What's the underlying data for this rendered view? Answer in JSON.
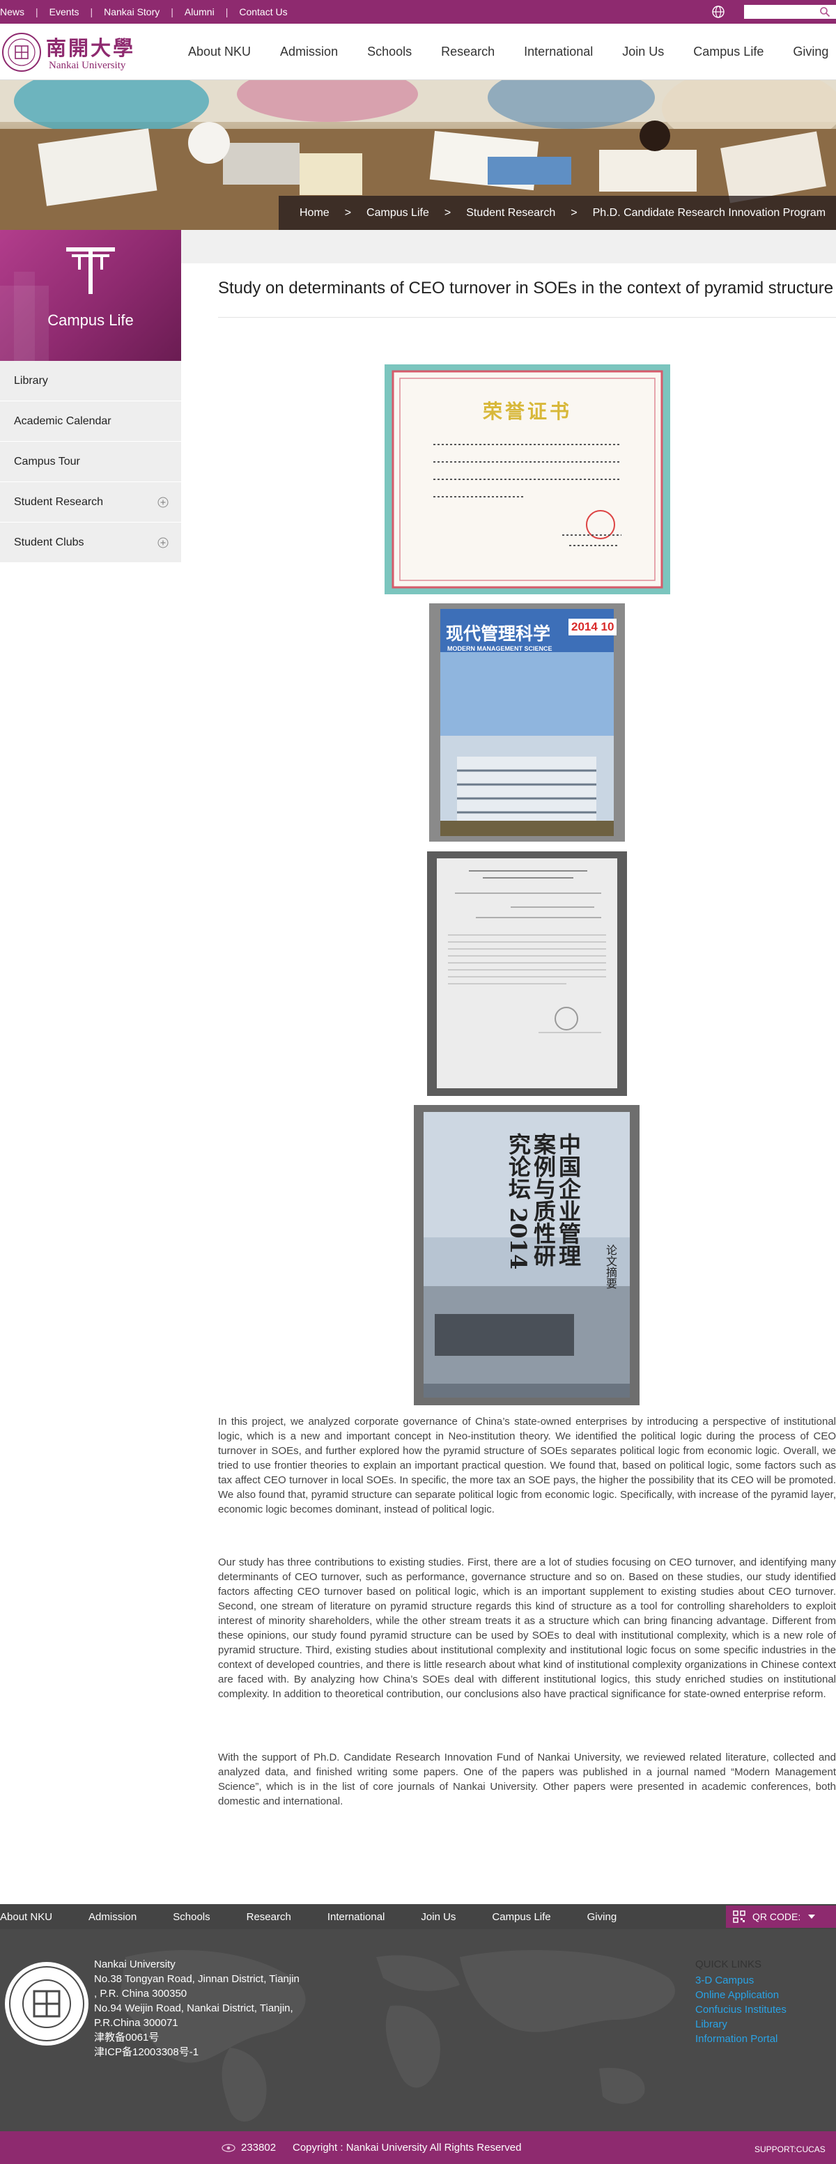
{
  "top_links": [
    "News",
    "Events",
    "Nankai Story",
    "Alumni",
    "Contact Us"
  ],
  "search": {
    "placeholder": ""
  },
  "logo": {
    "cn": "南開大學",
    "en": "Nankai University"
  },
  "main_nav": [
    "About NKU",
    "Admission",
    "Schools",
    "Research",
    "International",
    "Join Us",
    "Campus Life",
    "Giving"
  ],
  "breadcrumb": [
    "Home",
    "Campus Life",
    "Student Research",
    "Ph.D. Candidate Research Innovation Program"
  ],
  "breadcrumb_separator": ">",
  "sidebar": {
    "title": "Campus Life",
    "items": [
      {
        "label": "Library",
        "expandable": false
      },
      {
        "label": "Academic Calendar",
        "expandable": false
      },
      {
        "label": "Campus Tour",
        "expandable": false
      },
      {
        "label": "Student Research",
        "expandable": true
      },
      {
        "label": "Student Clubs",
        "expandable": true
      }
    ]
  },
  "article": {
    "title": "Study on determinants of CEO turnover in SOEs in the context of pyramid structure",
    "images": [
      {
        "heading": "荣誉证书"
      },
      {
        "heading": "现代管理科学",
        "subheading": "MODERN MANAGEMENT SCIENCE",
        "issue": "2014 10"
      },
      {
        "heading": ""
      },
      {
        "heading": "中国企业管理案例与质性研究论坛 2014",
        "side": "论文摘要"
      }
    ],
    "paragraphs": [
      "In this project, we analyzed corporate governance of China’s state-owned enterprises by introducing a perspective of institutional logic, which is a new and important concept in Neo-institution theory. We identified the political logic during the process of CEO turnover in SOEs, and further explored how the pyramid structure of SOEs separates political logic from economic logic. Overall, we tried to use frontier theories to explain an important practical question. We found that, based on political logic, some factors such as tax affect CEO turnover in local SOEs. In specific, the more tax an SOE pays, the higher the possibility that its CEO will be promoted. We also found that, pyramid structure can separate political logic from economic logic. Specifically, with increase of the pyramid layer, economic logic becomes dominant, instead of political logic.",
      "Our study has three contributions to existing studies. First, there are a lot of studies focusing on CEO turnover, and identifying many determinants of CEO turnover, such as performance, governance structure and so on. Based on these studies, our study identified factors affecting CEO turnover based on political logic, which is an important supplement to existing studies about CEO turnover. Second, one stream of literature on pyramid structure regards this kind of structure as a tool for controlling shareholders to exploit interest of minority shareholders, while the other stream treats it as a structure which can bring financing advantage. Different from these opinions, our study found pyramid structure can be used by SOEs to deal with institutional complexity, which is a new role of pyramid structure. Third, existing studies about institutional complexity and institutional logic focus on some specific industries in the context of developed countries, and there is little research about what kind of institutional complexity organizations in Chinese context are faced with. By analyzing how China’s SOEs deal with different institutional logics, this study enriched studies on institutional complexity. In addition to theoretical contribution, our conclusions also have practical significance for state-owned enterprise reform.",
      "With the support of Ph.D. Candidate Research Innovation Fund of Nankai University, we reviewed related literature, collected and analyzed data, and finished writing some papers. One of the papers was published in a journal named “Modern Management Science”, which is in the list of core journals of Nankai University. Other papers were presented in academic conferences, both domestic and international."
    ]
  },
  "footer_nav": [
    "About NKU",
    "Admission",
    "Schools",
    "Research",
    "International",
    "Join Us",
    "Campus Life",
    "Giving"
  ],
  "qr_label": "QR CODE:",
  "address_lines": [
    "Nankai University",
    "No.38 Tongyan Road, Jinnan District, Tianjin",
    ", P.R. China 300350",
    "No.94 Weijin Road,  Nankai District, Tianjin,",
    "P.R.China  300071",
    "津教备0061号",
    "津ICP备12003308号-1"
  ],
  "quick_links": {
    "title": "QUICK LINKS",
    "items": [
      "3-D Campus",
      "Online Application",
      "Confucius Institutes",
      "Library",
      "Information Portal"
    ]
  },
  "visit_count": "233802",
  "copyright": "Copyright : Nankai University All Rights Reserved",
  "support": "SUPPORT:CUCAS",
  "colors": {
    "brand": "#8e2a6f",
    "link": "#29a3e6",
    "footer_bg": "#4a4a4a"
  }
}
